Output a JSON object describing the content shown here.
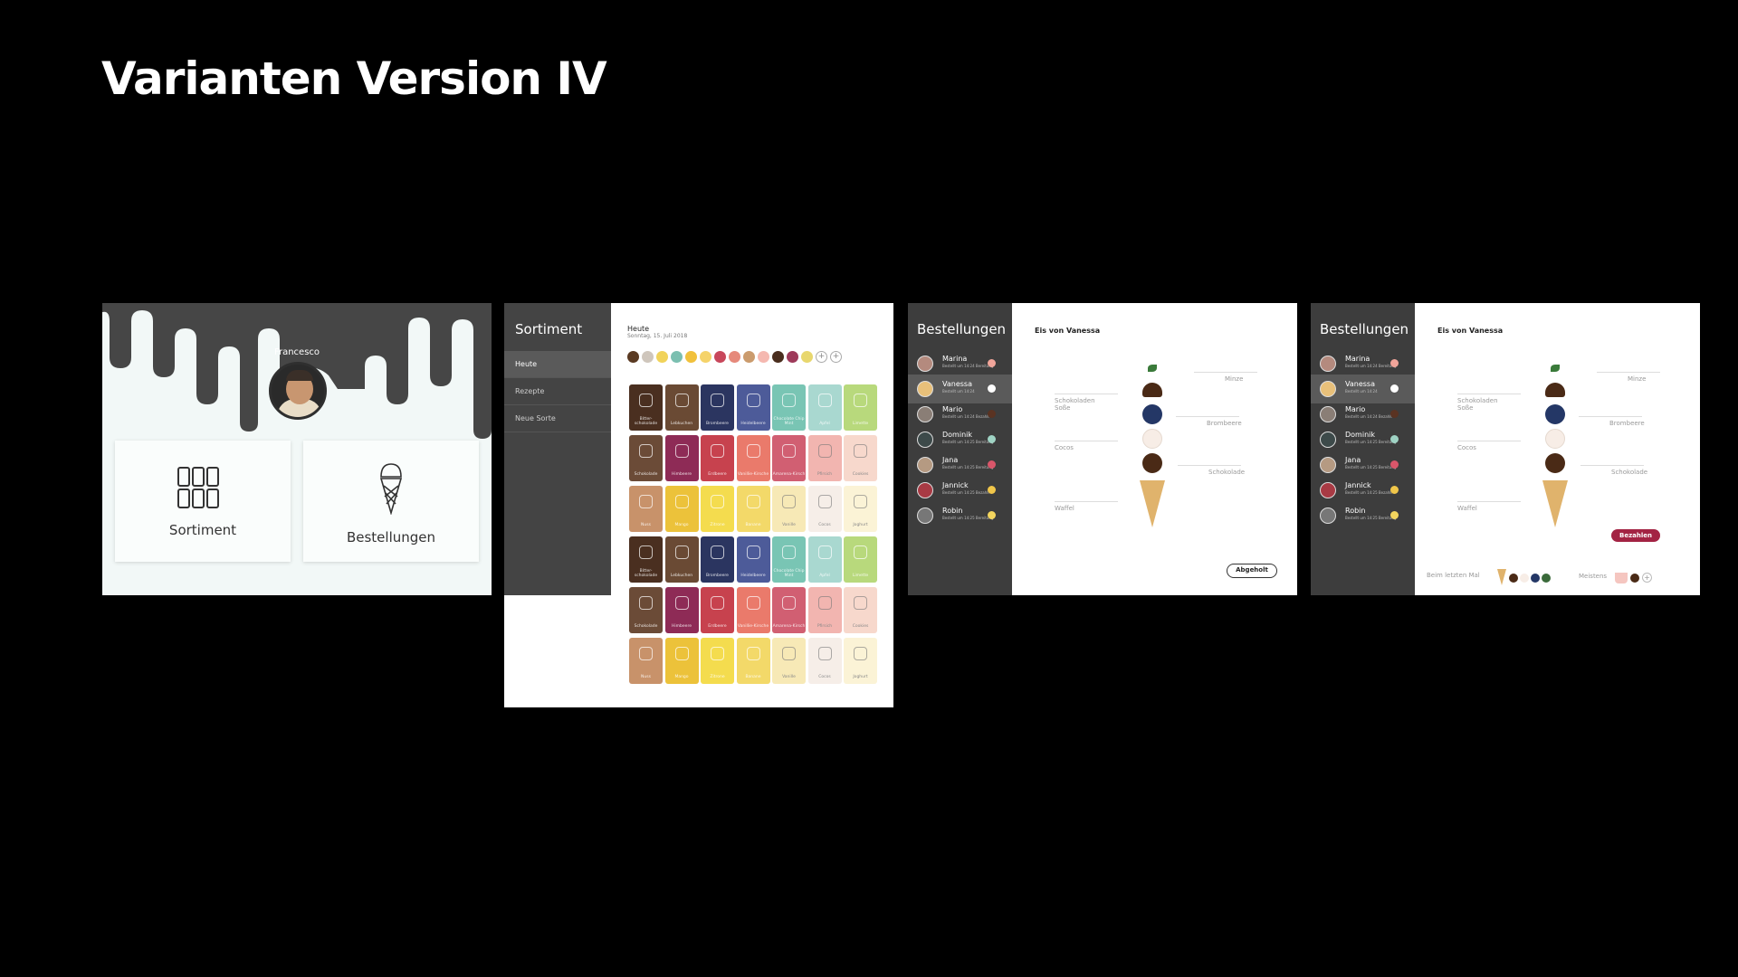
{
  "page": {
    "title": "Varianten Version IV"
  },
  "screen1": {
    "user": "Francesco",
    "cards": [
      {
        "label": "Sortiment",
        "icon": "grid-icon"
      },
      {
        "label": "Bestellungen",
        "icon": "ice-cream-icon"
      }
    ]
  },
  "screen2": {
    "sidebar": {
      "title": "Sortiment",
      "items": [
        "Heute",
        "Rezepte",
        "Neue Sorte"
      ]
    },
    "heading": "Heute",
    "date": "Sonntag, 15. Juli 2018",
    "dot_colors": [
      "#5a3a22",
      "#cfc6bc",
      "#f1d35a",
      "#7bbfb0",
      "#f1c13c",
      "#f5d36a",
      "#c8475b",
      "#e6897b",
      "#cb9b6d",
      "#f5b8b0",
      "#4a2e1e",
      "#9e3a5a",
      "#e8d76e"
    ],
    "tiles": [
      [
        "Bitter-schokolade",
        "#4a2f20",
        false
      ],
      [
        "Lebkuchen",
        "#6a4a34",
        false
      ],
      [
        "Brombeere",
        "#2b3560",
        false
      ],
      [
        "Heidelbeere",
        "#4d5b99",
        false
      ],
      [
        "Chocolate Chip Mint",
        "#79c5b4",
        false
      ],
      [
        "Apfel",
        "#a9d8d0",
        false
      ],
      [
        "Limette",
        "#b8d97c",
        false
      ],
      [
        "Schokolade",
        "#6b4b37",
        false
      ],
      [
        "Himbeere",
        "#8e2b56",
        false
      ],
      [
        "Erdbeere",
        "#c7424e",
        false
      ],
      [
        "Vanillie-Kirsche",
        "#ea7a6b",
        false
      ],
      [
        "Amarena-Kirsch",
        "#d15f72",
        false
      ],
      [
        "Pfirsich",
        "#f2b5b0",
        true
      ],
      [
        "Cookies",
        "#f7d8cc",
        true
      ],
      [
        "Nuss",
        "#c8926a",
        false
      ],
      [
        "Mango",
        "#ecc23a",
        false
      ],
      [
        "Zitrone",
        "#f4dc4e",
        false
      ],
      [
        "Banane",
        "#f3d969",
        false
      ],
      [
        "Vanille",
        "#f7e9b6",
        true
      ],
      [
        "Cocos",
        "#f6eee8",
        true
      ],
      [
        "Joghurt",
        "#fbf3d6",
        true
      ]
    ]
  },
  "screen3": {
    "sidebar_title": "Bestellungen",
    "orders": [
      {
        "name": "Marina",
        "sub": "Bestellt um 14:24 Bereitung",
        "icon_color": "#f1a59a",
        "avatar": "#b48a7e"
      },
      {
        "name": "Vanessa",
        "sub": "Bestellt um 14:24",
        "icon_color": "#ffffff",
        "avatar": "#e8c07a"
      },
      {
        "name": "Mario",
        "sub": "Bestellt um 14:24 Bezahlt",
        "icon_color": "#5a3322",
        "avatar": "#8a7e76"
      },
      {
        "name": "Dominik",
        "sub": "Bestellt um 14:25 Bereitung",
        "icon_color": "#9fd3c4",
        "avatar": "#3d4a4a"
      },
      {
        "name": "Jana",
        "sub": "Bestellt um 14:25 Bereitung",
        "icon_color": "#d9566a",
        "avatar": "#b59a82"
      },
      {
        "name": "Jannick",
        "sub": "Bestellt um 14:25 Bezahlt",
        "icon_color": "#f0c64a",
        "avatar": "#a83a44"
      },
      {
        "name": "Robin",
        "sub": "Bestellt um 14:25 Bereitung",
        "icon_color": "#f3d55e",
        "avatar": "#777"
      }
    ],
    "heading": "Eis von Vanessa",
    "labels": {
      "minze": "Minze",
      "sauce": "Schokoladen Soße",
      "brombeere": "Brombeere",
      "cocos": "Cocos",
      "schokolade": "Schokolade",
      "waffel": "Waffel"
    },
    "button": "Abgeholt"
  },
  "screen4": {
    "sidebar_title": "Bestellungen",
    "heading": "Eis von Vanessa",
    "button": "Bezahlen",
    "footer_left": "Beim letzten Mal",
    "footer_right": "Meistens"
  },
  "colors": {
    "dark": "#3d3d3d",
    "mint": "#f2f8f7",
    "berry": "#a32343",
    "navy": "#243766",
    "cocos": "#f7ede6",
    "choco": "#4a2a16"
  }
}
